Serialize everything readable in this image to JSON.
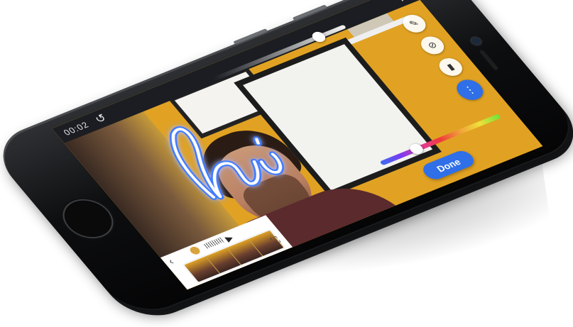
{
  "app": {
    "top_bar": {
      "timecode": "00:02",
      "undo_icon": "undo-icon",
      "close_icon": "close-icon"
    },
    "drawing": {
      "text": "hi",
      "stroke_color": "#3f7bff",
      "glow_color": "#ffffff"
    },
    "toolbar": [
      {
        "icon": "marker-icon",
        "glyph": "✎",
        "active": false
      },
      {
        "icon": "eraser-icon",
        "glyph": "⊘",
        "active": false
      },
      {
        "icon": "highlighter-icon",
        "glyph": "▮",
        "active": false
      },
      {
        "icon": "color-picker-icon",
        "glyph": "⋮",
        "active": true
      }
    ],
    "brush_size_fraction": 0.8,
    "color_slider_fraction": 0.3,
    "bottom_panel": {
      "back_icon": "chevron-left-icon",
      "play_icon": "play-icon",
      "fullscreen_icon": "fullscreen-icon"
    },
    "done_button": {
      "label": "Done"
    },
    "colors": {
      "accent": "#2f6fe8",
      "wall": "#e1a223",
      "phone": "#0d0e10"
    }
  }
}
